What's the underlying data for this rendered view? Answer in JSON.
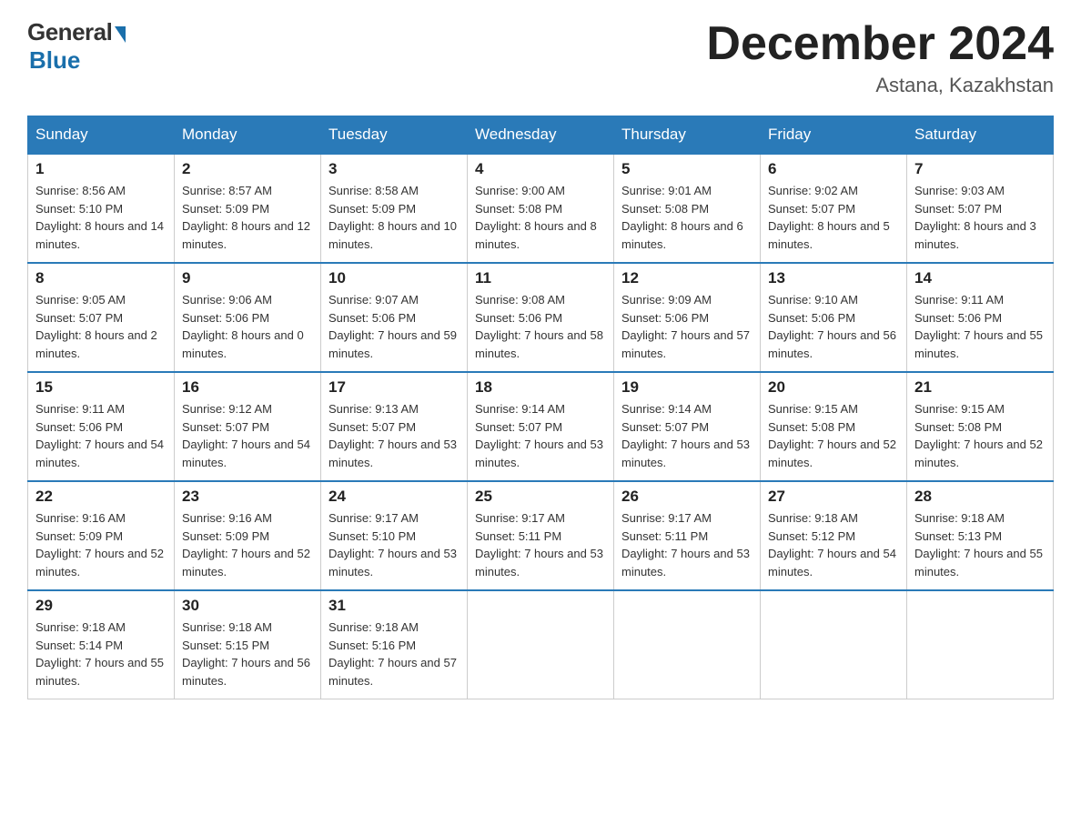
{
  "header": {
    "logo": {
      "general": "General",
      "blue": "Blue"
    },
    "title": "December 2024",
    "location": "Astana, Kazakhstan"
  },
  "days_of_week": [
    "Sunday",
    "Monday",
    "Tuesday",
    "Wednesday",
    "Thursday",
    "Friday",
    "Saturday"
  ],
  "weeks": [
    [
      {
        "day": "1",
        "sunrise": "8:56 AM",
        "sunset": "5:10 PM",
        "daylight": "8 hours and 14 minutes."
      },
      {
        "day": "2",
        "sunrise": "8:57 AM",
        "sunset": "5:09 PM",
        "daylight": "8 hours and 12 minutes."
      },
      {
        "day": "3",
        "sunrise": "8:58 AM",
        "sunset": "5:09 PM",
        "daylight": "8 hours and 10 minutes."
      },
      {
        "day": "4",
        "sunrise": "9:00 AM",
        "sunset": "5:08 PM",
        "daylight": "8 hours and 8 minutes."
      },
      {
        "day": "5",
        "sunrise": "9:01 AM",
        "sunset": "5:08 PM",
        "daylight": "8 hours and 6 minutes."
      },
      {
        "day": "6",
        "sunrise": "9:02 AM",
        "sunset": "5:07 PM",
        "daylight": "8 hours and 5 minutes."
      },
      {
        "day": "7",
        "sunrise": "9:03 AM",
        "sunset": "5:07 PM",
        "daylight": "8 hours and 3 minutes."
      }
    ],
    [
      {
        "day": "8",
        "sunrise": "9:05 AM",
        "sunset": "5:07 PM",
        "daylight": "8 hours and 2 minutes."
      },
      {
        "day": "9",
        "sunrise": "9:06 AM",
        "sunset": "5:06 PM",
        "daylight": "8 hours and 0 minutes."
      },
      {
        "day": "10",
        "sunrise": "9:07 AM",
        "sunset": "5:06 PM",
        "daylight": "7 hours and 59 minutes."
      },
      {
        "day": "11",
        "sunrise": "9:08 AM",
        "sunset": "5:06 PM",
        "daylight": "7 hours and 58 minutes."
      },
      {
        "day": "12",
        "sunrise": "9:09 AM",
        "sunset": "5:06 PM",
        "daylight": "7 hours and 57 minutes."
      },
      {
        "day": "13",
        "sunrise": "9:10 AM",
        "sunset": "5:06 PM",
        "daylight": "7 hours and 56 minutes."
      },
      {
        "day": "14",
        "sunrise": "9:11 AM",
        "sunset": "5:06 PM",
        "daylight": "7 hours and 55 minutes."
      }
    ],
    [
      {
        "day": "15",
        "sunrise": "9:11 AM",
        "sunset": "5:06 PM",
        "daylight": "7 hours and 54 minutes."
      },
      {
        "day": "16",
        "sunrise": "9:12 AM",
        "sunset": "5:07 PM",
        "daylight": "7 hours and 54 minutes."
      },
      {
        "day": "17",
        "sunrise": "9:13 AM",
        "sunset": "5:07 PM",
        "daylight": "7 hours and 53 minutes."
      },
      {
        "day": "18",
        "sunrise": "9:14 AM",
        "sunset": "5:07 PM",
        "daylight": "7 hours and 53 minutes."
      },
      {
        "day": "19",
        "sunrise": "9:14 AM",
        "sunset": "5:07 PM",
        "daylight": "7 hours and 53 minutes."
      },
      {
        "day": "20",
        "sunrise": "9:15 AM",
        "sunset": "5:08 PM",
        "daylight": "7 hours and 52 minutes."
      },
      {
        "day": "21",
        "sunrise": "9:15 AM",
        "sunset": "5:08 PM",
        "daylight": "7 hours and 52 minutes."
      }
    ],
    [
      {
        "day": "22",
        "sunrise": "9:16 AM",
        "sunset": "5:09 PM",
        "daylight": "7 hours and 52 minutes."
      },
      {
        "day": "23",
        "sunrise": "9:16 AM",
        "sunset": "5:09 PM",
        "daylight": "7 hours and 52 minutes."
      },
      {
        "day": "24",
        "sunrise": "9:17 AM",
        "sunset": "5:10 PM",
        "daylight": "7 hours and 53 minutes."
      },
      {
        "day": "25",
        "sunrise": "9:17 AM",
        "sunset": "5:11 PM",
        "daylight": "7 hours and 53 minutes."
      },
      {
        "day": "26",
        "sunrise": "9:17 AM",
        "sunset": "5:11 PM",
        "daylight": "7 hours and 53 minutes."
      },
      {
        "day": "27",
        "sunrise": "9:18 AM",
        "sunset": "5:12 PM",
        "daylight": "7 hours and 54 minutes."
      },
      {
        "day": "28",
        "sunrise": "9:18 AM",
        "sunset": "5:13 PM",
        "daylight": "7 hours and 55 minutes."
      }
    ],
    [
      {
        "day": "29",
        "sunrise": "9:18 AM",
        "sunset": "5:14 PM",
        "daylight": "7 hours and 55 minutes."
      },
      {
        "day": "30",
        "sunrise": "9:18 AM",
        "sunset": "5:15 PM",
        "daylight": "7 hours and 56 minutes."
      },
      {
        "day": "31",
        "sunrise": "9:18 AM",
        "sunset": "5:16 PM",
        "daylight": "7 hours and 57 minutes."
      },
      null,
      null,
      null,
      null
    ]
  ],
  "labels": {
    "sunrise": "Sunrise:",
    "sunset": "Sunset:",
    "daylight": "Daylight:"
  }
}
